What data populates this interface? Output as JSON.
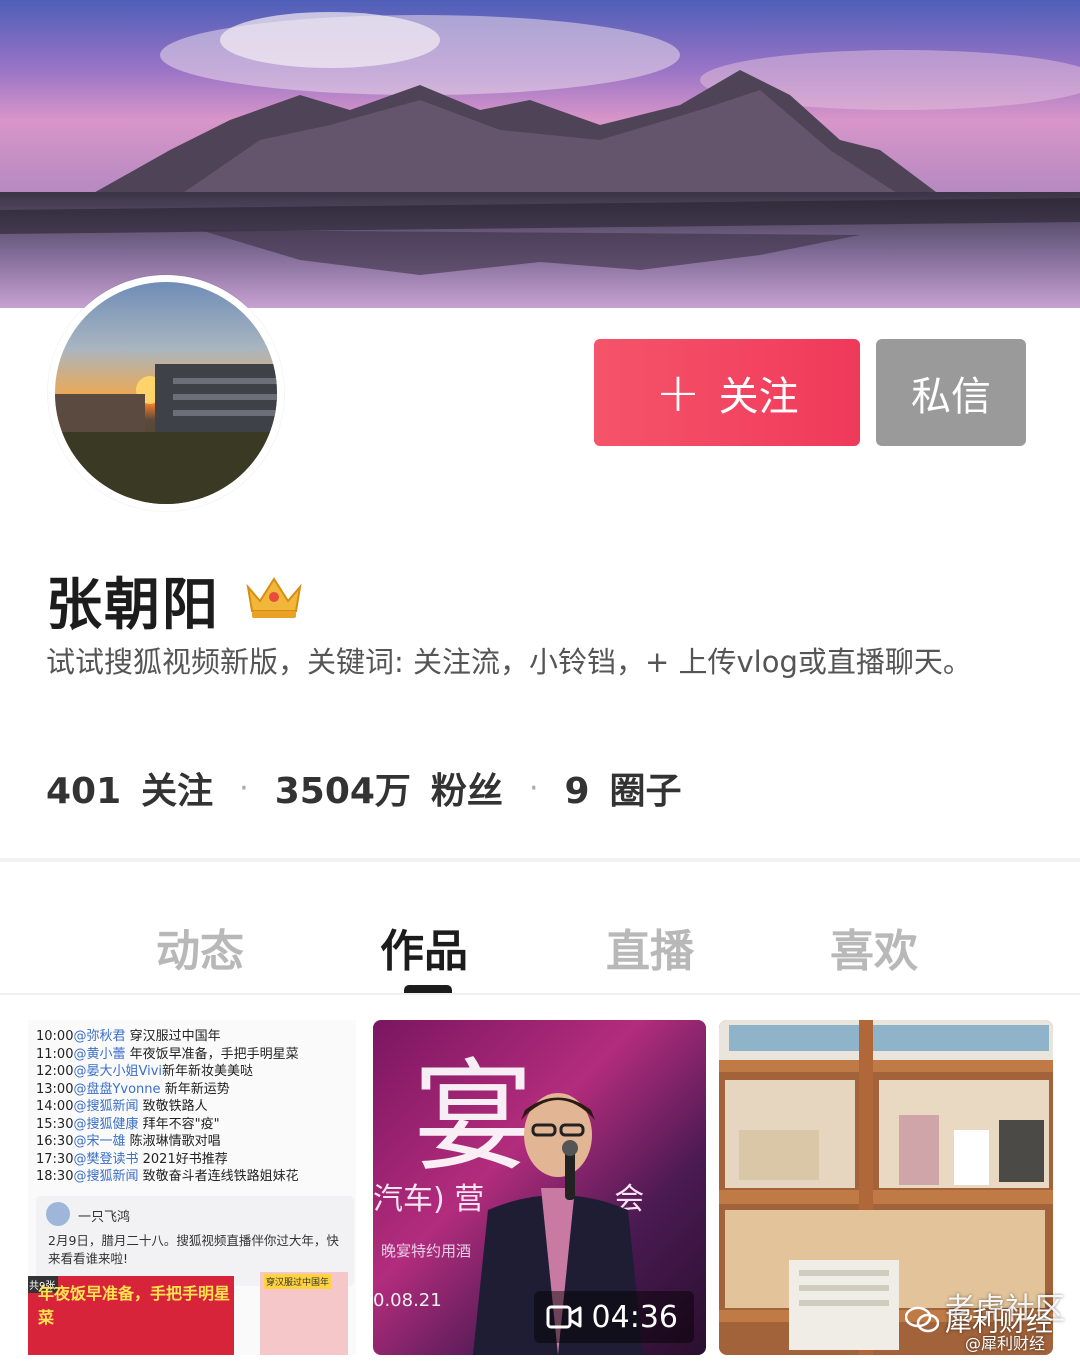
{
  "profile": {
    "name": "张朝阳",
    "bio": "试试搜狐视频新版，关键词: 关注流，小铃铛，+ 上传vlog或直播聊天。",
    "follow_plus": "+",
    "follow_label": "关注",
    "message_label": "私信",
    "crown_icon": "crown-icon"
  },
  "stats": {
    "following_count": "401",
    "following_label": "关注",
    "fans_count": "3504万",
    "fans_label": "粉丝",
    "circles_count": "9",
    "circles_label": "圈子",
    "separator": "·"
  },
  "tabs": [
    {
      "label": "动态"
    },
    {
      "label": "作品"
    },
    {
      "label": "直播"
    },
    {
      "label": "喜欢"
    }
  ],
  "active_tab": "作品",
  "grid": {
    "item1": {
      "schedule": [
        {
          "time": "10:00",
          "who": "@弥秋君",
          "what": "穿汉服过中国年"
        },
        {
          "time": "11:00",
          "who": "@黄小蕾",
          "what": "年夜饭早准备，手把手明星菜"
        },
        {
          "time": "12:00",
          "who": "@晏大小姐Vivi",
          "what": "新年新妆美美哒"
        },
        {
          "time": "13:00",
          "who": "@盘盘Yvonne",
          "what": "新年新运势"
        },
        {
          "time": "14:00",
          "who": "@搜狐新闻",
          "what": "致敬铁路人"
        },
        {
          "time": "15:30",
          "who": "@搜狐健康",
          "what": "拜年不容\"疫\""
        },
        {
          "time": "16:30",
          "who": "@宋一雄",
          "what": "陈淑琳情歌对唱"
        },
        {
          "time": "17:30",
          "who": "@樊登读书",
          "what": "2021好书推荐"
        },
        {
          "time": "18:30",
          "who": "@搜狐新闻",
          "what": "致敬奋斗者连线铁路姐妹花"
        }
      ],
      "card_user": "一只飞鸿",
      "card_text": "2月9日，腊月二十八。搜狐视频直播伴你过大年，快来看看谁来啦!",
      "promo_tag": "共9张",
      "promo_title": "年夜饭早准备，手把手明星菜",
      "promo2_title": "穿汉服过中国年"
    },
    "item2": {
      "big_char": "宴",
      "banner": "汽车) 营",
      "banner_right": "会",
      "sub": "晚宴特约用酒",
      "date": "0.08.21",
      "duration": "04:36",
      "duration_icon": "video-camera-icon"
    },
    "item3": {}
  },
  "watermark": {
    "line1": "老虎社区",
    "line2": "犀利财经",
    "line3": "@犀利财经",
    "wechat_icon": "wechat-icon"
  }
}
